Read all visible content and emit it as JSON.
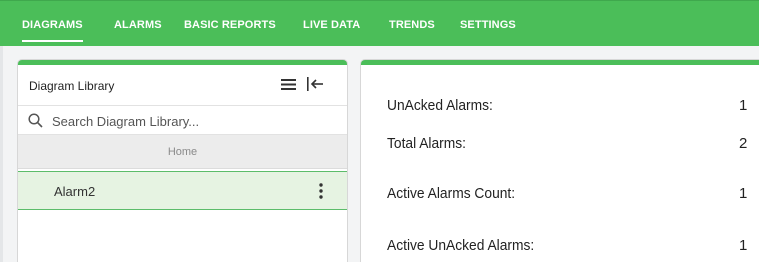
{
  "nav": {
    "items": [
      {
        "label": "DIAGRAMS",
        "active": true
      },
      {
        "label": "ALARMS"
      },
      {
        "label": "BASIC REPORTS"
      },
      {
        "label": "LIVE DATA"
      },
      {
        "label": "TRENDS"
      },
      {
        "label": "SETTINGS"
      }
    ]
  },
  "library": {
    "title": "Diagram Library",
    "search_placeholder": "Search Diagram Library...",
    "home_label": "Home",
    "items": [
      {
        "label": "Alarm2",
        "selected": true
      }
    ]
  },
  "stats": [
    {
      "label": "UnAcked Alarms:",
      "value": "1"
    },
    {
      "label": "Total Alarms:",
      "value": "2"
    },
    {
      "label": "Active Alarms Count:",
      "value": "1"
    },
    {
      "label": "Active UnAcked Alarms:",
      "value": "1"
    }
  ],
  "colors": {
    "accent": "#4bbe59",
    "selected_row": "#e6f3e2"
  },
  "icons": [
    "menu-icon",
    "collapse-panel-icon",
    "search-icon",
    "more-vertical-icon"
  ]
}
